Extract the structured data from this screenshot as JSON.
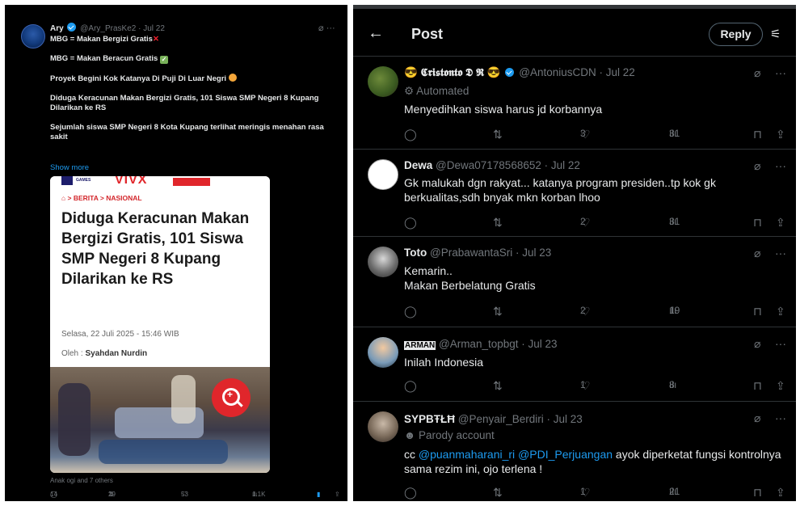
{
  "left_post": {
    "author_name": "Ary",
    "author_handle": "@Ary_PrasKe2 · Jul 22",
    "line1": "MBG = Makan Bergizi Gratis",
    "line2": "MBG = Makan Beracun Gratis",
    "line3": "Proyek Begini Kok Katanya Di Puji Di Luar Negri",
    "line4": "Diduga Keracunan Makan Bergizi Gratis, 101 Siswa SMP Negeri 8 Kupang Dilarikan ke RS",
    "line5": "Sejumlah siswa SMP Negeri 8 Kota Kupang terlihat meringis menahan rasa sakit",
    "show_more": "Show more",
    "card": {
      "brand_games": "GAMES",
      "brand_vivx": "VIVX",
      "breadcrumb": "BERITA",
      "breadcrumb2": "NASIONAL",
      "headline": "Diduga Keracunan Makan Bergizi Gratis, 101 Siswa SMP Negeri 8 Kupang Dilarikan ke RS",
      "date": "Selasa, 22 Juli 2025 - 15:46 WIB",
      "author_label": "Oleh :",
      "author": "Syahdan Nurdin"
    },
    "tagline": "Anak ogi and 7 others",
    "stats": {
      "replies": "14",
      "reposts": "29",
      "likes": "53",
      "views": "1.1K"
    }
  },
  "header": {
    "back": "←",
    "title": "Post",
    "reply_button": "Reply"
  },
  "replies": [
    {
      "name": "😎 𝕮𝖗𝖎𝖘𝖙𝖔𝖓𝖙𝖔 𝕯 𝕽 😎",
      "handle": "@AntoniusCDN · Jul 22",
      "sub": "Automated",
      "text": "Menyedihkan siswa harus jd korbannya",
      "replies": "",
      "reposts": "",
      "likes": "3",
      "views": "31"
    },
    {
      "name": "Dewa",
      "handle": "@Dewa07178568652 · Jul 22",
      "text": "Gk malukah dgn rakyat... katanya program presiden..tp kok gk berkualitas,sdh bnyak mkn korban lhoo",
      "likes": "2",
      "views": "31"
    },
    {
      "name": "Toto",
      "handle": "@PrabawantaSri · Jul 23",
      "text1": "Kemarin..",
      "text2": "Makan Berbelatung Gratis",
      "likes": "2",
      "views": "19"
    },
    {
      "name": "ARMAN",
      "handle": "@Arman_topbgt · Jul 23",
      "text": "Inilah Indonesia",
      "likes": "1",
      "views": "8"
    },
    {
      "name": "ЅΥΡΒŦŁĦ",
      "handle": "@Penyair_Berdiri · Jul 23",
      "sub": "Parody account",
      "prefix": "cc ",
      "mention1": "@puanmaharani_ri",
      "mention2": "@PDI_Perjuangan",
      "text": " ayok diperketat fungsi kontrolnya sama rezim ini, ojo terlena !",
      "likes": "1",
      "views": "21"
    }
  ],
  "colors": {
    "background": "#000000",
    "accent": "#1d9bf0",
    "muted": "#71767b",
    "text": "#e7e9ea",
    "news_red": "#e0262b"
  }
}
